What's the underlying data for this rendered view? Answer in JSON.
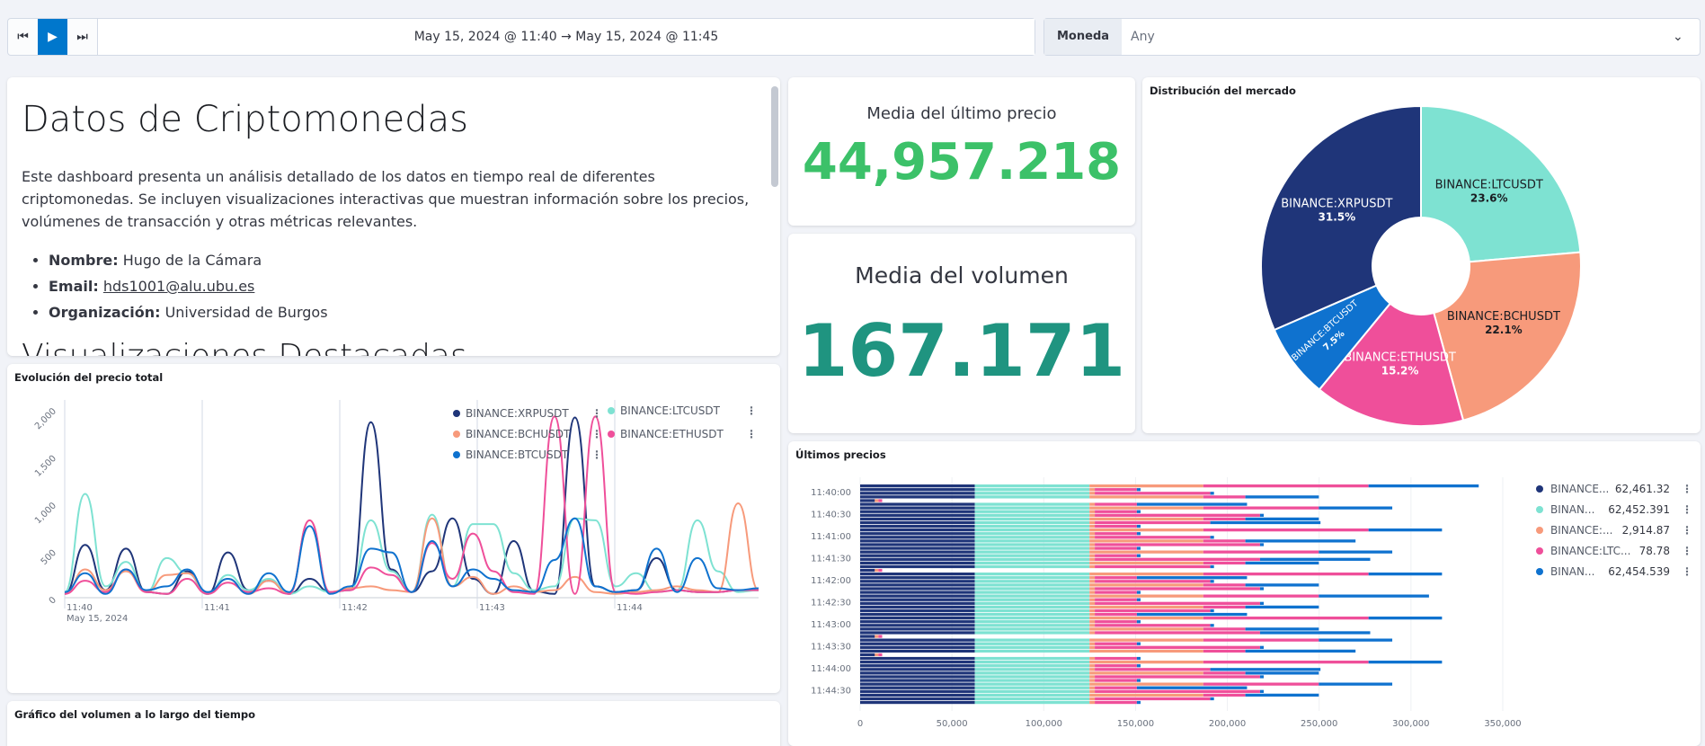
{
  "controls": {
    "date_range": "May 15, 2024 @ 11:40  →  May 15, 2024 @ 11:45",
    "moneda_label": "Moneda",
    "moneda_value": "Any"
  },
  "markdown": {
    "title": "Datos de Criptomonedas",
    "description": "Este dashboard presenta un análisis detallado de los datos en tiempo real de diferentes criptomonedas. Se incluyen visualizaciones interactivas que muestran información sobre los precios, volúmenes de transacción y otras métricas relevantes.",
    "items": [
      {
        "key": "Nombre:",
        "value": " Hugo de la Cámara"
      },
      {
        "key": "Email:",
        "value": "hds1001@alu.ubu.es"
      },
      {
        "key": "Organización:",
        "value": " Universidad de Burgos"
      }
    ],
    "next_heading": "Visualizaciones Destacadas"
  },
  "metric_price": {
    "title": "Media del último precio",
    "value": "44,957.218",
    "color": "#3cc169"
  },
  "metric_volume": {
    "title": "Media del volumen",
    "value": "167.171",
    "color": "#1f9480"
  },
  "panels": {
    "line_title": "Evolución del precio total",
    "volume_title": "Gráfico del volumen a lo largo del tiempo",
    "pie_title": "Distribución del mercado",
    "bars_title": "Últimos precios"
  },
  "colors": {
    "xrp": "#1f3579",
    "ltc": "#7ee2d2",
    "bch": "#f79a7b",
    "eth": "#ef4f9a",
    "btc": "#0f72cf"
  },
  "chart_data": [
    {
      "type": "line",
      "title": "Evolución del precio total",
      "x_ticks": [
        "11:40",
        "11:41",
        "11:42",
        "11:43",
        "11:44"
      ],
      "x_date": "May 15, 2024",
      "y_ticks": [
        "0",
        "500",
        "1,000",
        "1,500",
        "2,000"
      ],
      "ylim": [
        0,
        2000
      ],
      "legend": [
        "BINANCE:XRPUSDT",
        "BINANCE:LTCUSDT",
        "BINANCE:BCHUSDT",
        "BINANCE:ETHUSDT",
        "BINANCE:BTCUSDT"
      ],
      "series": [
        {
          "name": "BINANCE:XRPUSDT",
          "values": [
            40,
            560,
            80,
            520,
            60,
            40,
            280,
            40,
            480,
            80,
            180,
            40,
            200,
            60,
            80,
            1860,
            300,
            60,
            280,
            840,
            200,
            40,
            600,
            70,
            40,
            1910,
            120,
            60,
            80,
            420,
            80,
            60,
            60,
            80,
            80
          ]
        },
        {
          "name": "BINANCE:LTCUSDT",
          "values": [
            60,
            1100,
            120,
            380,
            60,
            420,
            260,
            40,
            240,
            80,
            200,
            40,
            120,
            60,
            80,
            820,
            280,
            60,
            880,
            120,
            780,
            780,
            260,
            80,
            120,
            840,
            820,
            120,
            260,
            60,
            80,
            820,
            280,
            60,
            80
          ]
        },
        {
          "name": "BINANCE:BCHUSDT",
          "values": [
            40,
            300,
            80,
            280,
            60,
            240,
            260,
            60,
            200,
            40,
            180,
            40,
            820,
            60,
            100,
            120,
            80,
            60,
            840,
            120,
            220,
            40,
            120,
            60,
            80,
            220,
            60,
            40,
            60,
            80,
            120,
            80,
            60,
            1000,
            80
          ]
        },
        {
          "name": "BINANCE:ETHUSDT",
          "values": [
            40,
            180,
            60,
            300,
            60,
            40,
            200,
            40,
            160,
            60,
            100,
            40,
            820,
            60,
            80,
            320,
            240,
            60,
            580,
            200,
            680,
            280,
            60,
            40,
            1920,
            40,
            1920,
            60,
            40,
            60,
            80,
            60,
            60,
            80,
            80
          ]
        },
        {
          "name": "BINANCE:BTCUSDT",
          "values": [
            60,
            260,
            40,
            300,
            80,
            120,
            300,
            60,
            200,
            40,
            260,
            60,
            760,
            40,
            120,
            520,
            480,
            60,
            600,
            120,
            300,
            200,
            80,
            60,
            400,
            840,
            120,
            60,
            80,
            520,
            60,
            420,
            100,
            80,
            100
          ]
        }
      ]
    },
    {
      "type": "pie",
      "title": "Distribución del mercado",
      "categories": [
        "BINANCE:LTCUSDT",
        "BINANCE:BCHUSDT",
        "BINANCE:ETHUSDT",
        "BINANCE:BTCUSDT",
        "BINANCE:XRPUSDT"
      ],
      "values": [
        23.6,
        22.1,
        15.2,
        7.5,
        31.5
      ],
      "labels": [
        "23.6%",
        "22.1%",
        "15.2%",
        "7.5%",
        "31.5%"
      ]
    },
    {
      "type": "bar",
      "orientation": "horizontal",
      "stacked": true,
      "title": "Últimos precios",
      "y_ticks": [
        "11:40:00",
        "11:40:30",
        "11:41:00",
        "11:41:30",
        "11:42:00",
        "11:42:30",
        "11:43:00",
        "11:43:30",
        "11:44:00",
        "11:44:30"
      ],
      "x_ticks": [
        "0",
        "50,000",
        "100,000",
        "150,000",
        "200,000",
        "250,000",
        "300,000",
        "350,000"
      ],
      "xlim": [
        0,
        350000
      ],
      "legend": [
        {
          "name": "BINANCE...",
          "value": "62,461.32"
        },
        {
          "name": "BINAN...",
          "value": "62,452.391"
        },
        {
          "name": "BINANCE:...",
          "value": "2,914.87"
        },
        {
          "name": "BINANCE:LTC...",
          "value": "78.78"
        },
        {
          "name": "BINAN...",
          "value": "62,454.539"
        }
      ]
    }
  ]
}
